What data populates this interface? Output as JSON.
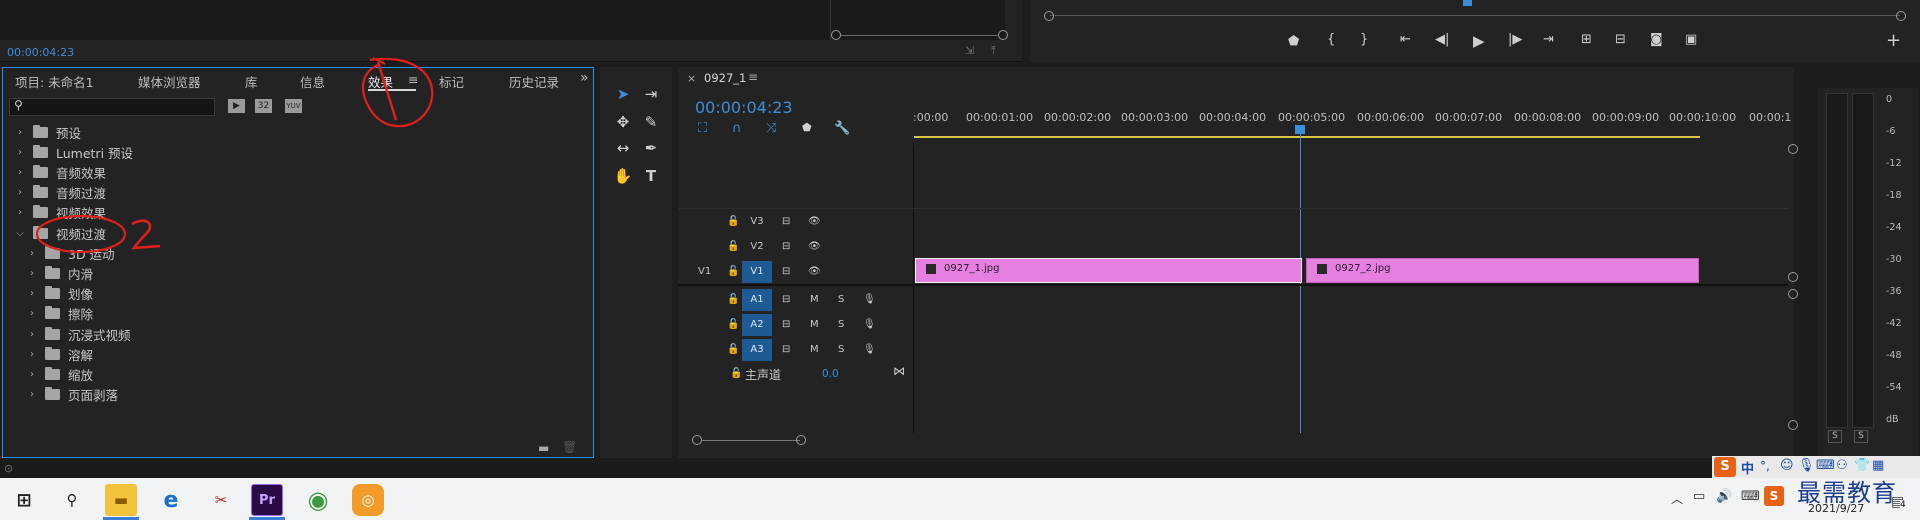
{
  "top": {
    "timecode": "00:00:04:23"
  },
  "project_panel": {
    "tabs": [
      "项目: 未命名1",
      "媒体浏览器",
      "库",
      "信息",
      "效果",
      "标记",
      "历史记录"
    ],
    "active_tab": "效果",
    "search_placeholder": "",
    "filter_buttons": [
      "32",
      "YUV"
    ],
    "tree": [
      {
        "label": "预设",
        "expanded": false,
        "level": 0
      },
      {
        "label": "Lumetri 预设",
        "expanded": false,
        "level": 0
      },
      {
        "label": "音频效果",
        "expanded": false,
        "level": 0
      },
      {
        "label": "音频过渡",
        "expanded": false,
        "level": 0
      },
      {
        "label": "视频效果",
        "expanded": false,
        "level": 0
      },
      {
        "label": "视频过渡",
        "expanded": true,
        "level": 0
      },
      {
        "label": "3D 运动",
        "expanded": false,
        "level": 1
      },
      {
        "label": "内滑",
        "expanded": false,
        "level": 1
      },
      {
        "label": "划像",
        "expanded": false,
        "level": 1
      },
      {
        "label": "擦除",
        "expanded": false,
        "level": 1
      },
      {
        "label": "沉浸式视频",
        "expanded": false,
        "level": 1
      },
      {
        "label": "溶解",
        "expanded": false,
        "level": 1
      },
      {
        "label": "缩放",
        "expanded": false,
        "level": 1
      },
      {
        "label": "页面剥落",
        "expanded": false,
        "level": 1
      }
    ],
    "annotations": [
      "1",
      "2"
    ]
  },
  "timeline": {
    "tab_name": "0927_1",
    "timecode": "00:00:04:23",
    "ruler": [
      ":00:00",
      "00:00:01:00",
      "00:00:02:00",
      "00:00:03:00",
      "00:00:04:00",
      "00:00:05:00",
      "00:00:06:00",
      "00:00:07:00",
      "00:00:08:00",
      "00:00:09:00",
      "00:00:10:00",
      "00:00:1"
    ],
    "video_tracks": [
      {
        "name": "V3",
        "target": false,
        "src": ""
      },
      {
        "name": "V2",
        "target": false,
        "src": ""
      },
      {
        "name": "V1",
        "target": true,
        "src": "V1"
      }
    ],
    "audio_tracks": [
      {
        "name": "A1",
        "m": "M",
        "s": "S"
      },
      {
        "name": "A2",
        "m": "M",
        "s": "S"
      },
      {
        "name": "A3",
        "m": "M",
        "s": "S"
      }
    ],
    "master": {
      "label": "主声道",
      "value": "0.0"
    },
    "clips": [
      {
        "name": "0927_1.jpg"
      },
      {
        "name": "0927_2.jpg"
      }
    ]
  },
  "audio_meter": {
    "scale": [
      "0",
      "-6",
      "-12",
      "-18",
      "-24",
      "-30",
      "-36",
      "-42",
      "-48",
      "-54",
      "dB"
    ],
    "solo": [
      "S",
      "S"
    ]
  },
  "taskbar": {
    "ime": "中",
    "time": "",
    "date": "2021/9/27",
    "watermark": "最需教育",
    "notif_count": "4"
  },
  "colors": {
    "accent": "#2d8ceb",
    "clip": "#e57fe0",
    "annotation": "#e0201c",
    "timecode": "#3b8ed8"
  }
}
